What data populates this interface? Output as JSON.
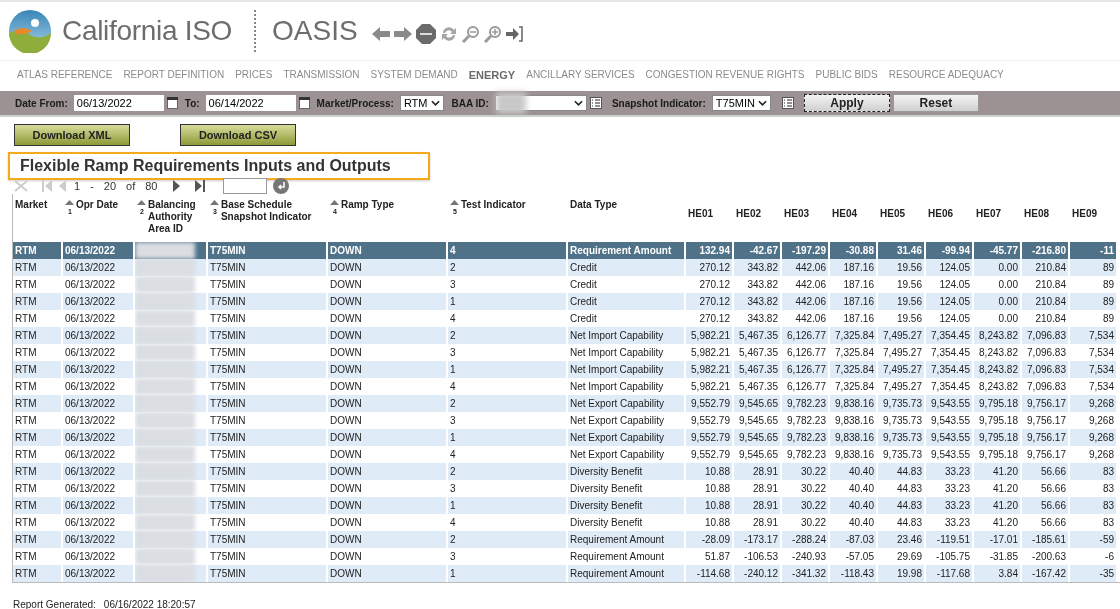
{
  "header": {
    "logo_text": "California ISO",
    "app_name": "OASIS"
  },
  "nav": [
    {
      "label": "ATLAS REFERENCE",
      "selected": false
    },
    {
      "label": "REPORT DEFINITION",
      "selected": false
    },
    {
      "label": "PRICES",
      "selected": false
    },
    {
      "label": "TRANSMISSION",
      "selected": false
    },
    {
      "label": "SYSTEM DEMAND",
      "selected": false
    },
    {
      "label": "ENERGY",
      "selected": true
    },
    {
      "label": "ANCILLARY SERVICES",
      "selected": false
    },
    {
      "label": "CONGESTION REVENUE RIGHTS",
      "selected": false
    },
    {
      "label": "PUBLIC BIDS",
      "selected": false
    },
    {
      "label": "RESOURCE ADEQUACY",
      "selected": false
    }
  ],
  "filters": {
    "date_from_label": "Date From:",
    "date_from": "06/13/2022",
    "to_label": "To:",
    "date_to": "06/14/2022",
    "market_label": "Market/Process:",
    "market": "RTM",
    "baa_label": "BAA ID:",
    "snapshot_label": "Snapshot Indicator:",
    "snapshot": "T75MIN",
    "apply": "Apply",
    "reset": "Reset"
  },
  "downloads": [
    "Download XML",
    "Download CSV"
  ],
  "report_title": "Flexible Ramp Requirements Inputs and Outputs",
  "pager": {
    "from": "1",
    "dash": "-",
    "to": "20",
    "of": "of",
    "total": "80"
  },
  "table": {
    "columns": [
      {
        "label": "Market",
        "kind": "text"
      },
      {
        "label": "Opr Date",
        "kind": "text",
        "sort": "1"
      },
      {
        "label": "Balancing Authority Area ID",
        "kind": "redacted",
        "sort": "2"
      },
      {
        "label": "Base Schedule Snapshot Indicator",
        "kind": "text",
        "sort": "3"
      },
      {
        "label": "Ramp Type",
        "kind": "text",
        "sort": "4"
      },
      {
        "label": "Test Indicator",
        "kind": "text",
        "sort": "5"
      },
      {
        "label": "Data Type",
        "kind": "text"
      },
      {
        "label": "HE01",
        "kind": "number"
      },
      {
        "label": "HE02",
        "kind": "number"
      },
      {
        "label": "HE03",
        "kind": "number"
      },
      {
        "label": "HE04",
        "kind": "number"
      },
      {
        "label": "HE05",
        "kind": "number"
      },
      {
        "label": "HE06",
        "kind": "number"
      },
      {
        "label": "HE07",
        "kind": "number"
      },
      {
        "label": "HE08",
        "kind": "number"
      },
      {
        "label": "HE09",
        "kind": "number"
      }
    ],
    "rows": [
      {
        "selected": true,
        "cells": [
          "RTM",
          "06/13/2022",
          "",
          "T75MIN",
          "DOWN",
          "4",
          "Requirement Amount",
          "132.94",
          "-42.67",
          "-197.29",
          "-30.88",
          "31.46",
          "-99.94",
          "-45.77",
          "-216.80",
          "-11"
        ]
      },
      {
        "selected": false,
        "cells": [
          "RTM",
          "06/13/2022",
          "",
          "T75MIN",
          "DOWN",
          "2",
          "Credit",
          "270.12",
          "343.82",
          "442.06",
          "187.16",
          "19.56",
          "124.05",
          "0.00",
          "210.84",
          "89"
        ]
      },
      {
        "selected": false,
        "cells": [
          "RTM",
          "06/13/2022",
          "",
          "T75MIN",
          "DOWN",
          "3",
          "Credit",
          "270.12",
          "343.82",
          "442.06",
          "187.16",
          "19.56",
          "124.05",
          "0.00",
          "210.84",
          "89"
        ]
      },
      {
        "selected": false,
        "cells": [
          "RTM",
          "06/13/2022",
          "",
          "T75MIN",
          "DOWN",
          "1",
          "Credit",
          "270.12",
          "343.82",
          "442.06",
          "187.16",
          "19.56",
          "124.05",
          "0.00",
          "210.84",
          "89"
        ]
      },
      {
        "selected": false,
        "cells": [
          "RTM",
          "06/13/2022",
          "",
          "T75MIN",
          "DOWN",
          "4",
          "Credit",
          "270.12",
          "343.82",
          "442.06",
          "187.16",
          "19.56",
          "124.05",
          "0.00",
          "210.84",
          "89"
        ]
      },
      {
        "selected": false,
        "cells": [
          "RTM",
          "06/13/2022",
          "",
          "T75MIN",
          "DOWN",
          "2",
          "Net Import Capability",
          "5,982.21",
          "5,467.35",
          "6,126.77",
          "7,325.84",
          "7,495.27",
          "7,354.45",
          "8,243.82",
          "7,096.83",
          "7,534"
        ]
      },
      {
        "selected": false,
        "cells": [
          "RTM",
          "06/13/2022",
          "",
          "T75MIN",
          "DOWN",
          "3",
          "Net Import Capability",
          "5,982.21",
          "5,467.35",
          "6,126.77",
          "7,325.84",
          "7,495.27",
          "7,354.45",
          "8,243.82",
          "7,096.83",
          "7,534"
        ]
      },
      {
        "selected": false,
        "cells": [
          "RTM",
          "06/13/2022",
          "",
          "T75MIN",
          "DOWN",
          "1",
          "Net Import Capability",
          "5,982.21",
          "5,467.35",
          "6,126.77",
          "7,325.84",
          "7,495.27",
          "7,354.45",
          "8,243.82",
          "7,096.83",
          "7,534"
        ]
      },
      {
        "selected": false,
        "cells": [
          "RTM",
          "06/13/2022",
          "",
          "T75MIN",
          "DOWN",
          "4",
          "Net Import Capability",
          "5,982.21",
          "5,467.35",
          "6,126.77",
          "7,325.84",
          "7,495.27",
          "7,354.45",
          "8,243.82",
          "7,096.83",
          "7,534"
        ]
      },
      {
        "selected": false,
        "cells": [
          "RTM",
          "06/13/2022",
          "",
          "T75MIN",
          "DOWN",
          "2",
          "Net Export Capability",
          "9,552.79",
          "9,545.65",
          "9,782.23",
          "9,838.16",
          "9,735.73",
          "9,543.55",
          "9,795.18",
          "9,756.17",
          "9,268"
        ]
      },
      {
        "selected": false,
        "cells": [
          "RTM",
          "06/13/2022",
          "",
          "T75MIN",
          "DOWN",
          "3",
          "Net Export Capability",
          "9,552.79",
          "9,545.65",
          "9,782.23",
          "9,838.16",
          "9,735.73",
          "9,543.55",
          "9,795.18",
          "9,756.17",
          "9,268"
        ]
      },
      {
        "selected": false,
        "cells": [
          "RTM",
          "06/13/2022",
          "",
          "T75MIN",
          "DOWN",
          "1",
          "Net Export Capability",
          "9,552.79",
          "9,545.65",
          "9,782.23",
          "9,838.16",
          "9,735.73",
          "9,543.55",
          "9,795.18",
          "9,756.17",
          "9,268"
        ]
      },
      {
        "selected": false,
        "cells": [
          "RTM",
          "06/13/2022",
          "",
          "T75MIN",
          "DOWN",
          "4",
          "Net Export Capability",
          "9,552.79",
          "9,545.65",
          "9,782.23",
          "9,838.16",
          "9,735.73",
          "9,543.55",
          "9,795.18",
          "9,756.17",
          "9,268"
        ]
      },
      {
        "selected": false,
        "cells": [
          "RTM",
          "06/13/2022",
          "",
          "T75MIN",
          "DOWN",
          "2",
          "Diversity Benefit",
          "10.88",
          "28.91",
          "30.22",
          "40.40",
          "44.83",
          "33.23",
          "41.20",
          "56.66",
          "83"
        ]
      },
      {
        "selected": false,
        "cells": [
          "RTM",
          "06/13/2022",
          "",
          "T75MIN",
          "DOWN",
          "3",
          "Diversity Benefit",
          "10.88",
          "28.91",
          "30.22",
          "40.40",
          "44.83",
          "33.23",
          "41.20",
          "56.66",
          "83"
        ]
      },
      {
        "selected": false,
        "cells": [
          "RTM",
          "06/13/2022",
          "",
          "T75MIN",
          "DOWN",
          "1",
          "Diversity Benefit",
          "10.88",
          "28.91",
          "30.22",
          "40.40",
          "44.83",
          "33.23",
          "41.20",
          "56.66",
          "83"
        ]
      },
      {
        "selected": false,
        "cells": [
          "RTM",
          "06/13/2022",
          "",
          "T75MIN",
          "DOWN",
          "4",
          "Diversity Benefit",
          "10.88",
          "28.91",
          "30.22",
          "40.40",
          "44.83",
          "33.23",
          "41.20",
          "56.66",
          "83"
        ]
      },
      {
        "selected": false,
        "cells": [
          "RTM",
          "06/13/2022",
          "",
          "T75MIN",
          "DOWN",
          "2",
          "Requirement Amount",
          "-28.09",
          "-173.17",
          "-288.24",
          "-87.03",
          "23.46",
          "-119.51",
          "-17.01",
          "-185.61",
          "-59"
        ]
      },
      {
        "selected": false,
        "cells": [
          "RTM",
          "06/13/2022",
          "",
          "T75MIN",
          "DOWN",
          "3",
          "Requirement Amount",
          "51.87",
          "-106.53",
          "-240.93",
          "-57.05",
          "29.69",
          "-105.75",
          "-31.85",
          "-200.63",
          "-6"
        ]
      },
      {
        "selected": false,
        "cells": [
          "RTM",
          "06/13/2022",
          "",
          "T75MIN",
          "DOWN",
          "1",
          "Requirement Amount",
          "-114.68",
          "-240.12",
          "-341.32",
          "-118.43",
          "19.98",
          "-117.68",
          "3.84",
          "-167.42",
          "-35"
        ]
      }
    ]
  },
  "footer": {
    "label": "Report Generated:",
    "value": "06/16/2022 18:20:57"
  }
}
